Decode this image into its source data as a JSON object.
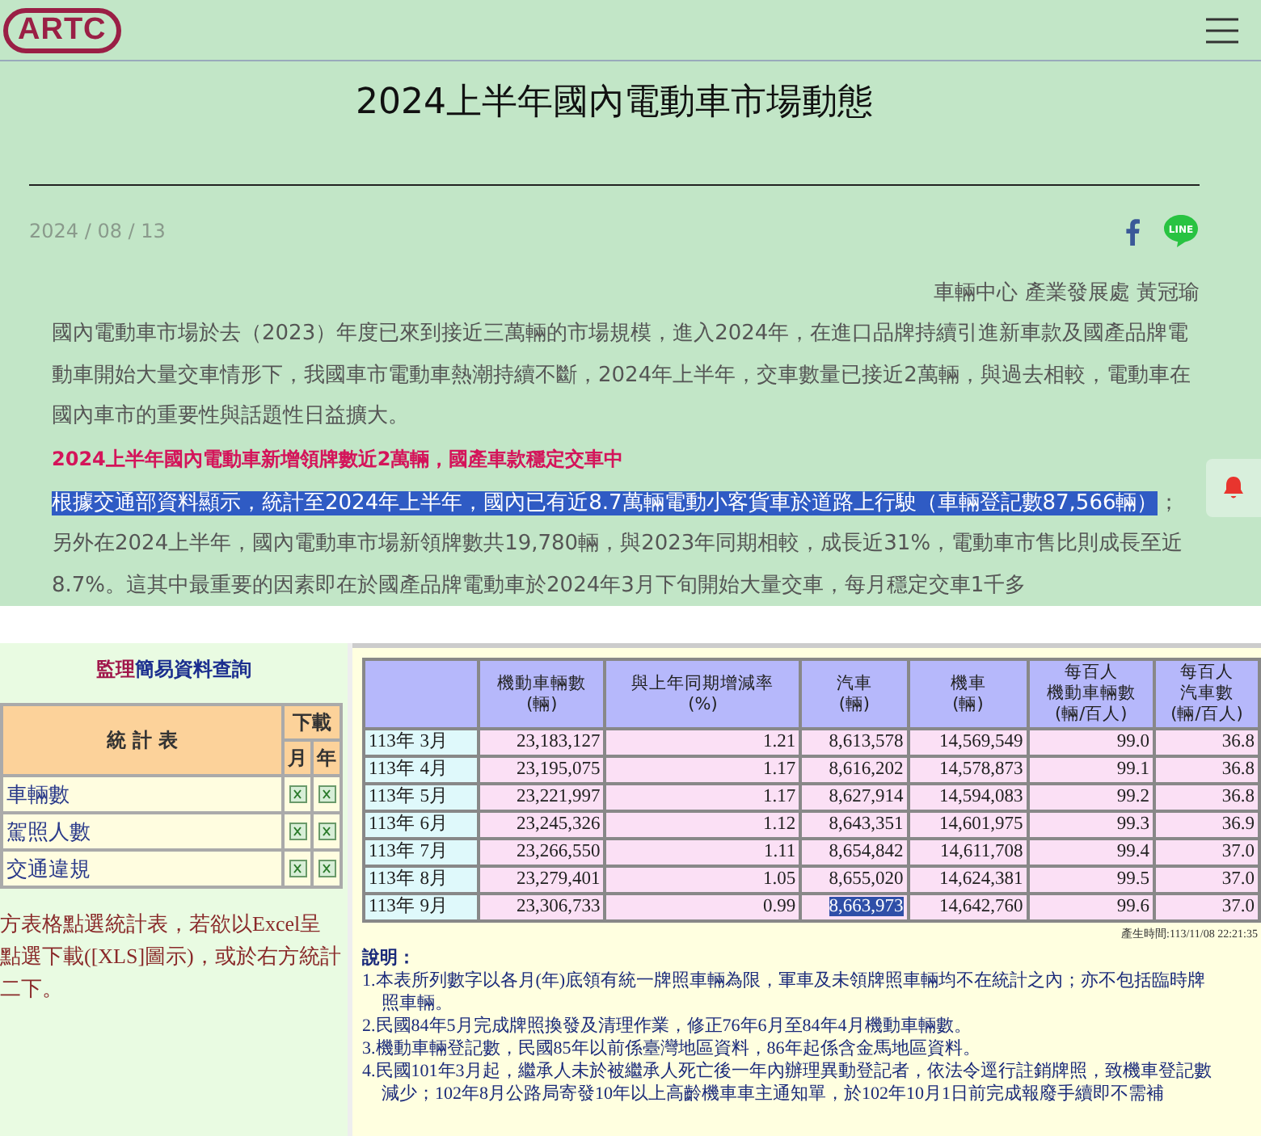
{
  "header": {
    "logo": "ARTC"
  },
  "share": {
    "line_label": "LINE"
  },
  "article": {
    "title": "2024上半年國內電動車市場動態",
    "date": "2024 / 08 / 13",
    "author": "車輛中心 產業發展處 黃冠瑜",
    "paragraphs": [
      {
        "kind": "text",
        "segments": [
          {
            "text": "國內電動車市場於去（2023）年度已來到接近三萬輛的市場規模，進入2024年，在進口品牌持續引進新車款及國產品牌電動車開始大量交車情形下，我國車市電動車熱潮持續不斷，2024年上半年，交車數量已接近2萬輛，與過去相較，電動車在國內車市的重要性與話題性日益擴大。",
            "selected": false
          }
        ]
      },
      {
        "kind": "heading",
        "segments": [
          {
            "text": "2024上半年國內電動車新增領牌數近2萬輛，國產車款穩定交車中",
            "selected": false
          }
        ]
      },
      {
        "kind": "text",
        "segments": [
          {
            "text": "根據交通部資料顯示，統計至2024年上半年，國內已有近8.7萬輛電動小客貨車於道路上行駛（車輛登記數87,566輛）",
            "selected": true
          },
          {
            "text": "；另外在2024上半年，國內電動車市場新領牌數共19,780輛，與2023年同期相較，成長近31%，電動車市售比則成長至近8.7%。這其中最重要的因素即在於國產品牌電動車於2024年3月下旬開始大量交車，每月穩定交車1千多",
            "selected": false
          }
        ]
      }
    ]
  },
  "screenshot": {
    "sidebar": {
      "title_red": "監理",
      "title_blue": "簡易資料查詢",
      "column_header": "統 計 表",
      "download_header": "下載",
      "month": "月",
      "year": "年",
      "items": [
        "車輛數",
        "駕照人數",
        "交通違規"
      ],
      "note_lines": [
        "方表格點選統計表，若欲以Excel呈",
        "點選下載([XLS]圖示)，或於右方統計",
        "二下。"
      ]
    },
    "table": {
      "columns": [
        {},
        {
          "lines": [
            "機動車輛數",
            "(輛)"
          ]
        },
        {
          "lines": [
            "與上年同期增減率",
            "(%)"
          ]
        },
        {
          "lines": [
            "汽車",
            "(輛)"
          ]
        },
        {
          "lines": [
            "機車",
            "(輛)"
          ]
        },
        {
          "lines": [
            "每百人",
            "機動車輛數",
            "(輛/百人)"
          ]
        },
        {
          "lines": [
            "每百人",
            "汽車數",
            "(輛/百人)"
          ]
        }
      ],
      "rows": [
        {
          "cells": [
            {
              "text": "113年 3月",
              "selected": false
            },
            {
              "text": "23,183,127",
              "selected": false
            },
            {
              "text": "1.21",
              "selected": false
            },
            {
              "text": "8,613,578",
              "selected": false
            },
            {
              "text": "14,569,549",
              "selected": false
            },
            {
              "text": "99.0",
              "selected": false
            },
            {
              "text": "36.8",
              "selected": false
            }
          ]
        },
        {
          "cells": [
            {
              "text": "113年 4月",
              "selected": false
            },
            {
              "text": "23,195,075",
              "selected": false
            },
            {
              "text": "1.17",
              "selected": false
            },
            {
              "text": "8,616,202",
              "selected": false
            },
            {
              "text": "14,578,873",
              "selected": false
            },
            {
              "text": "99.1",
              "selected": false
            },
            {
              "text": "36.8",
              "selected": false
            }
          ]
        },
        {
          "cells": [
            {
              "text": "113年 5月",
              "selected": false
            },
            {
              "text": "23,221,997",
              "selected": false
            },
            {
              "text": "1.17",
              "selected": false
            },
            {
              "text": "8,627,914",
              "selected": false
            },
            {
              "text": "14,594,083",
              "selected": false
            },
            {
              "text": "99.2",
              "selected": false
            },
            {
              "text": "36.8",
              "selected": false
            }
          ]
        },
        {
          "cells": [
            {
              "text": "113年 6月",
              "selected": false
            },
            {
              "text": "23,245,326",
              "selected": false
            },
            {
              "text": "1.12",
              "selected": false
            },
            {
              "text": "8,643,351",
              "selected": false
            },
            {
              "text": "14,601,975",
              "selected": false
            },
            {
              "text": "99.3",
              "selected": false
            },
            {
              "text": "36.9",
              "selected": false
            }
          ]
        },
        {
          "cells": [
            {
              "text": "113年 7月",
              "selected": false
            },
            {
              "text": "23,266,550",
              "selected": false
            },
            {
              "text": "1.11",
              "selected": false
            },
            {
              "text": "8,654,842",
              "selected": false
            },
            {
              "text": "14,611,708",
              "selected": false
            },
            {
              "text": "99.4",
              "selected": false
            },
            {
              "text": "37.0",
              "selected": false
            }
          ]
        },
        {
          "cells": [
            {
              "text": "113年 8月",
              "selected": false
            },
            {
              "text": "23,279,401",
              "selected": false
            },
            {
              "text": "1.05",
              "selected": false
            },
            {
              "text": "8,655,020",
              "selected": false
            },
            {
              "text": "14,624,381",
              "selected": false
            },
            {
              "text": "99.5",
              "selected": false
            },
            {
              "text": "37.0",
              "selected": false
            }
          ]
        },
        {
          "cells": [
            {
              "text": "113年 9月",
              "selected": false
            },
            {
              "text": "23,306,733",
              "selected": false
            },
            {
              "text": "0.99",
              "selected": false
            },
            {
              "text": "8,663,973",
              "selected": true
            },
            {
              "text": "14,642,760",
              "selected": false
            },
            {
              "text": "99.6",
              "selected": false
            },
            {
              "text": "37.0",
              "selected": false
            }
          ]
        }
      ],
      "timestamp": "產生時間:113/11/08 22:21:35"
    },
    "notes": {
      "title": "說明：",
      "items": [
        "1.本表所列數字以各月(年)底領有統一牌照車輛為限，軍車及未領牌照車輛均不在統計之內；亦不包括臨時牌照車輛。",
        "2.民國84年5月完成牌照換發及清理作業，修正76年6月至84年4月機動車輛數。",
        "3.機動車輛登記數，民國85年以前係臺灣地區資料，86年起係含金馬地區資料。",
        "4.民國101年3月起，繼承人未於被繼承人死亡後一年內辦理異動登記者，依法令逕行註銷牌照，致機車登記數減少；102年8月公路局寄發10年以上高齡機車車主通知單，於102年10月1日前完成報廢手續即不需補"
      ]
    }
  }
}
